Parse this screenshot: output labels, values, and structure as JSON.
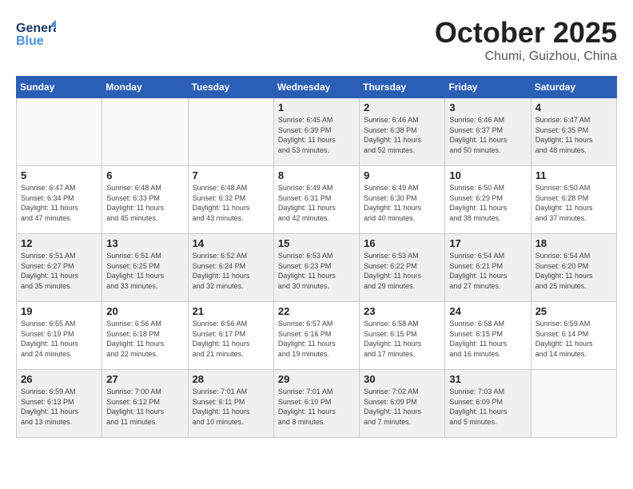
{
  "logo": {
    "line1": "General",
    "line2": "Blue"
  },
  "title": "October 2025",
  "location": "Chumi, Guizhou, China",
  "weekdays": [
    "Sunday",
    "Monday",
    "Tuesday",
    "Wednesday",
    "Thursday",
    "Friday",
    "Saturday"
  ],
  "weeks": [
    [
      {
        "day": "",
        "info": ""
      },
      {
        "day": "",
        "info": ""
      },
      {
        "day": "",
        "info": ""
      },
      {
        "day": "1",
        "info": "Sunrise: 6:45 AM\nSunset: 6:39 PM\nDaylight: 11 hours\nand 53 minutes."
      },
      {
        "day": "2",
        "info": "Sunrise: 6:46 AM\nSunset: 6:38 PM\nDaylight: 11 hours\nand 52 minutes."
      },
      {
        "day": "3",
        "info": "Sunrise: 6:46 AM\nSunset: 6:37 PM\nDaylight: 11 hours\nand 50 minutes."
      },
      {
        "day": "4",
        "info": "Sunrise: 6:47 AM\nSunset: 6:35 PM\nDaylight: 11 hours\nand 48 minutes."
      }
    ],
    [
      {
        "day": "5",
        "info": "Sunrise: 6:47 AM\nSunset: 6:34 PM\nDaylight: 11 hours\nand 47 minutes."
      },
      {
        "day": "6",
        "info": "Sunrise: 6:48 AM\nSunset: 6:33 PM\nDaylight: 11 hours\nand 45 minutes."
      },
      {
        "day": "7",
        "info": "Sunrise: 6:48 AM\nSunset: 6:32 PM\nDaylight: 11 hours\nand 43 minutes."
      },
      {
        "day": "8",
        "info": "Sunrise: 6:49 AM\nSunset: 6:31 PM\nDaylight: 11 hours\nand 42 minutes."
      },
      {
        "day": "9",
        "info": "Sunrise: 6:49 AM\nSunset: 6:30 PM\nDaylight: 11 hours\nand 40 minutes."
      },
      {
        "day": "10",
        "info": "Sunrise: 6:50 AM\nSunset: 6:29 PM\nDaylight: 11 hours\nand 38 minutes."
      },
      {
        "day": "11",
        "info": "Sunrise: 6:50 AM\nSunset: 6:28 PM\nDaylight: 11 hours\nand 37 minutes."
      }
    ],
    [
      {
        "day": "12",
        "info": "Sunrise: 6:51 AM\nSunset: 6:27 PM\nDaylight: 11 hours\nand 35 minutes."
      },
      {
        "day": "13",
        "info": "Sunrise: 6:51 AM\nSunset: 6:25 PM\nDaylight: 11 hours\nand 33 minutes."
      },
      {
        "day": "14",
        "info": "Sunrise: 6:52 AM\nSunset: 6:24 PM\nDaylight: 11 hours\nand 32 minutes."
      },
      {
        "day": "15",
        "info": "Sunrise: 6:53 AM\nSunset: 6:23 PM\nDaylight: 11 hours\nand 30 minutes."
      },
      {
        "day": "16",
        "info": "Sunrise: 6:53 AM\nSunset: 6:22 PM\nDaylight: 11 hours\nand 29 minutes."
      },
      {
        "day": "17",
        "info": "Sunrise: 6:54 AM\nSunset: 6:21 PM\nDaylight: 11 hours\nand 27 minutes."
      },
      {
        "day": "18",
        "info": "Sunrise: 6:54 AM\nSunset: 6:20 PM\nDaylight: 11 hours\nand 25 minutes."
      }
    ],
    [
      {
        "day": "19",
        "info": "Sunrise: 6:55 AM\nSunset: 6:19 PM\nDaylight: 11 hours\nand 24 minutes."
      },
      {
        "day": "20",
        "info": "Sunrise: 6:56 AM\nSunset: 6:18 PM\nDaylight: 11 hours\nand 22 minutes."
      },
      {
        "day": "21",
        "info": "Sunrise: 6:56 AM\nSunset: 6:17 PM\nDaylight: 11 hours\nand 21 minutes."
      },
      {
        "day": "22",
        "info": "Sunrise: 6:57 AM\nSunset: 6:16 PM\nDaylight: 11 hours\nand 19 minutes."
      },
      {
        "day": "23",
        "info": "Sunrise: 6:58 AM\nSunset: 6:15 PM\nDaylight: 11 hours\nand 17 minutes."
      },
      {
        "day": "24",
        "info": "Sunrise: 6:58 AM\nSunset: 6:15 PM\nDaylight: 11 hours\nand 16 minutes."
      },
      {
        "day": "25",
        "info": "Sunrise: 6:59 AM\nSunset: 6:14 PM\nDaylight: 11 hours\nand 14 minutes."
      }
    ],
    [
      {
        "day": "26",
        "info": "Sunrise: 6:59 AM\nSunset: 6:13 PM\nDaylight: 11 hours\nand 13 minutes."
      },
      {
        "day": "27",
        "info": "Sunrise: 7:00 AM\nSunset: 6:12 PM\nDaylight: 11 hours\nand 11 minutes."
      },
      {
        "day": "28",
        "info": "Sunrise: 7:01 AM\nSunset: 6:11 PM\nDaylight: 11 hours\nand 10 minutes."
      },
      {
        "day": "29",
        "info": "Sunrise: 7:01 AM\nSunset: 6:10 PM\nDaylight: 11 hours\nand 8 minutes."
      },
      {
        "day": "30",
        "info": "Sunrise: 7:02 AM\nSunset: 6:09 PM\nDaylight: 11 hours\nand 7 minutes."
      },
      {
        "day": "31",
        "info": "Sunrise: 7:03 AM\nSunset: 6:09 PM\nDaylight: 11 hours\nand 5 minutes."
      },
      {
        "day": "",
        "info": ""
      }
    ]
  ]
}
